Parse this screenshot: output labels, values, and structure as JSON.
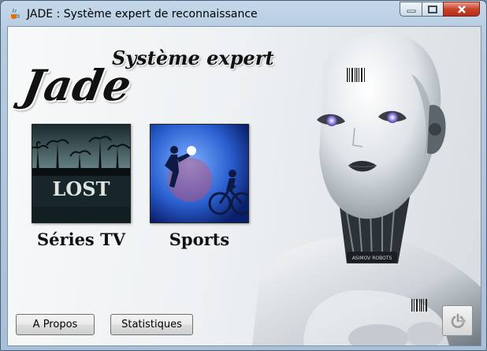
{
  "window": {
    "title": "JADE : Système expert de reconnaissance",
    "icon": "java-cup-icon",
    "controls": [
      "minimize-icon",
      "maximize-icon",
      "close-icon"
    ]
  },
  "logo": {
    "main": "Jade",
    "subtitle": "Système expert"
  },
  "categories": [
    {
      "label": "Séries TV",
      "image_text": "LOST"
    },
    {
      "label": "Sports"
    }
  ],
  "buttons": {
    "about": "A Propos",
    "stats": "Statistiques",
    "exit_icon": "exit-power-icon"
  },
  "colors": {
    "close_button": "#c7432b",
    "window_frame": "#b6cce1"
  }
}
